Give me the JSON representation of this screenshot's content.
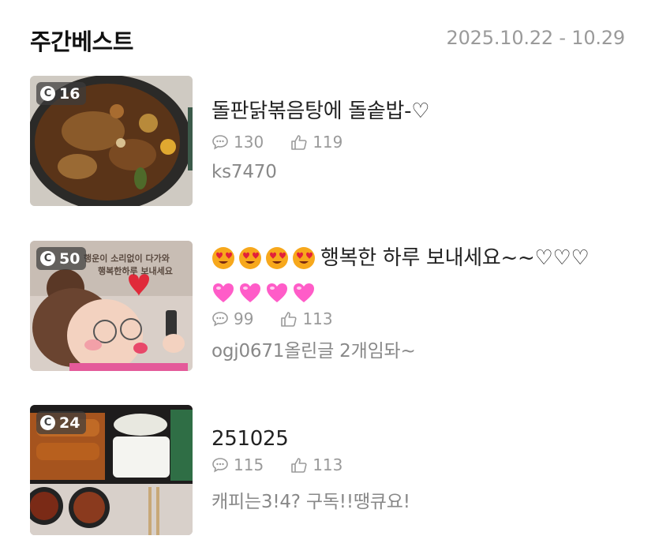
{
  "header": {
    "title": "주간베스트",
    "date_range": "2025.10.22 - 10.29"
  },
  "items": [
    {
      "rank": "16",
      "title": "돌판닭볶음탕에 돌솥밥-♡",
      "comments": "130",
      "likes": "119",
      "author": "ks7470",
      "thumb_desc_icon": "braised-chicken-photo"
    },
    {
      "rank": "50",
      "title": "행복한 하루 보내세요~~♡♡♡",
      "comments": "99",
      "likes": "113",
      "author": "ogj0671올린글 2개임돠~",
      "thumb_caption_1": "행운이 소리없이 다가와",
      "thumb_caption_2": "행복한하루 보내세요"
    },
    {
      "rank": "24",
      "title": "251025",
      "comments": "115",
      "likes": "113",
      "author": "캐피는3!4? 구독!!땡큐요!"
    }
  ],
  "icons": {
    "badge": "chat-badge-icon",
    "comment": "comment-bubble-icon",
    "like": "thumbs-up-icon"
  },
  "colors": {
    "meta_gray": "#9a9a9a",
    "badge_bg": "#3c3c3c",
    "heart_emoji": "#ff4fb8"
  }
}
